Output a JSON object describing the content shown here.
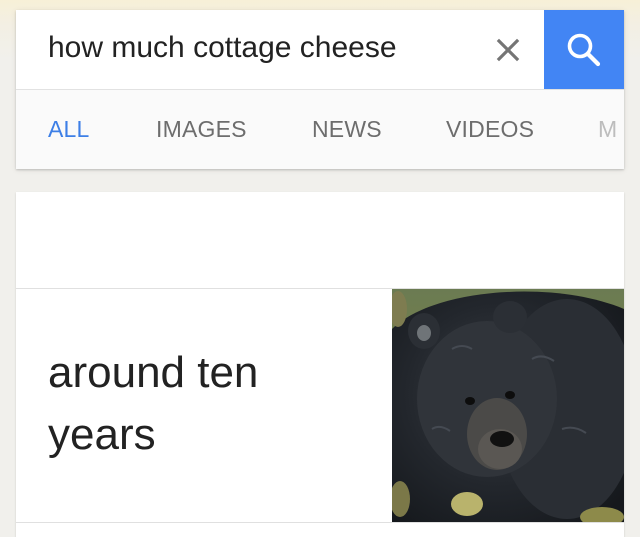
{
  "search": {
    "query": "how much cottage cheese",
    "clear_icon": "close-icon",
    "search_icon": "search-icon",
    "accent_color": "#4285f4"
  },
  "tabs": [
    {
      "label": "ALL",
      "active": true
    },
    {
      "label": "IMAGES",
      "active": false
    },
    {
      "label": "NEWS",
      "active": false
    },
    {
      "label": "VIDEOS",
      "active": false
    },
    {
      "label": "M",
      "active": false
    }
  ],
  "result": {
    "answer_line_1": "around ten",
    "answer_line_2": "years",
    "image": "black-bear-photo"
  }
}
